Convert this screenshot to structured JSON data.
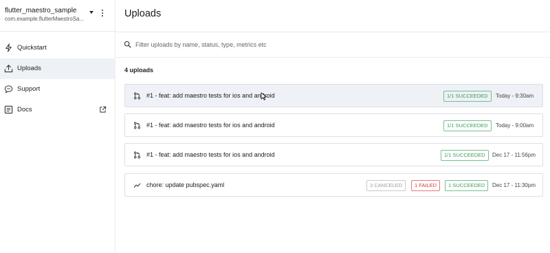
{
  "app": {
    "name": "flutter_maestro_sample",
    "id": "com.example.flutterMaestroSa..."
  },
  "sidebar": {
    "items": [
      {
        "label": "Quickstart",
        "icon": "lightning-icon",
        "active": false
      },
      {
        "label": "Uploads",
        "icon": "upload-icon",
        "active": true
      },
      {
        "label": "Support",
        "icon": "chat-bubble-icon",
        "active": false
      },
      {
        "label": "Docs",
        "icon": "document-icon",
        "active": false,
        "external": true
      }
    ]
  },
  "main": {
    "title": "Uploads",
    "search": {
      "placeholder": "Filter uploads by name, status, type, metrics etc",
      "value": ""
    },
    "count_label": "4 uploads",
    "uploads": [
      {
        "icon": "pull-request-icon",
        "title": "#1 - feat: add maestro tests for ios and android",
        "badges": [
          {
            "text": "1/1 SUCCEEDED",
            "kind": "ok"
          }
        ],
        "date": "Today - 9:30am"
      },
      {
        "icon": "pull-request-icon",
        "title": "#1 - feat: add maestro tests for ios and android",
        "badges": [
          {
            "text": "1/1 SUCCEEDED",
            "kind": "ok"
          }
        ],
        "date": "Today - 9:00am"
      },
      {
        "icon": "pull-request-icon",
        "title": "#1 - feat: add maestro tests for ios and android",
        "badges": [
          {
            "text": "1/1 SUCCEEDED",
            "kind": "ok"
          }
        ],
        "date": "Dec 17 - 11:56pm"
      },
      {
        "icon": "trend-icon",
        "title": "chore: update pubspec.yaml",
        "badges": [
          {
            "text": "3 CANCELED",
            "kind": "cancel"
          },
          {
            "text": "1 FAILED",
            "kind": "fail"
          },
          {
            "text": "1 SUCCEEDED",
            "kind": "ok"
          }
        ],
        "date": "Dec 17 - 11:30pm"
      }
    ]
  },
  "colors": {
    "accent_success": "#3e9a5b",
    "accent_fail": "#d9363e",
    "muted": "#9aa0a6",
    "active_bg": "#eef1f5"
  }
}
